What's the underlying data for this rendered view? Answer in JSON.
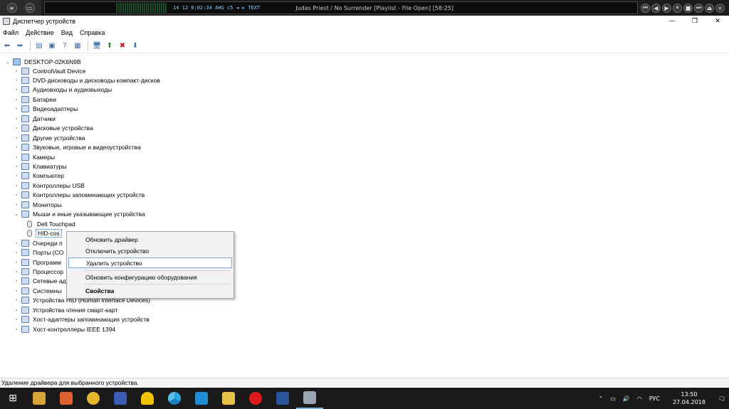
{
  "winamp": {
    "info": "14   12   0:02:34   AHG   c5   ◄   ►   TEXT",
    "track": "Judas Priest / No Surrender    [Playlist - File Open]  [58:25]"
  },
  "window": {
    "title": "Диспетчер устройств"
  },
  "menu": [
    "Файл",
    "Действие",
    "Вид",
    "Справка"
  ],
  "tree": {
    "root": "DESKTOP-02K6N9B",
    "items": [
      {
        "label": "ControlVault Device",
        "expanded": false
      },
      {
        "label": "DVD-дисководы и дисководы компакт-дисков",
        "expanded": false
      },
      {
        "label": "Аудиовходы и аудиовыходы",
        "expanded": false
      },
      {
        "label": "Батареи",
        "expanded": false
      },
      {
        "label": "Видеоадаптеры",
        "expanded": false
      },
      {
        "label": "Датчики",
        "expanded": false
      },
      {
        "label": "Дисковые устройства",
        "expanded": false
      },
      {
        "label": "Другие устройства",
        "expanded": false
      },
      {
        "label": "Звуковые, игровые и видеоустройства",
        "expanded": false
      },
      {
        "label": "Камеры",
        "expanded": false
      },
      {
        "label": "Клавиатуры",
        "expanded": false
      },
      {
        "label": "Компьютер",
        "expanded": false
      },
      {
        "label": "Контроллеры USB",
        "expanded": false
      },
      {
        "label": "Контроллеры запоминающих устройств",
        "expanded": false
      },
      {
        "label": "Мониторы",
        "expanded": false
      },
      {
        "label": "Мыши и иные указывающие устройства",
        "expanded": true
      },
      {
        "label": "Dell Touchpad",
        "child": true
      },
      {
        "label": "HID-cos",
        "child": true,
        "selected": true
      },
      {
        "label": "Очереди п",
        "expanded": false
      },
      {
        "label": "Порты (CO",
        "expanded": false
      },
      {
        "label": "Программ",
        "expanded": false
      },
      {
        "label": "Процессор",
        "expanded": false
      },
      {
        "label": "Сетевые ад",
        "expanded": false
      },
      {
        "label": "Системны",
        "expanded": false
      },
      {
        "label": "Устройства HID (Human Interface Devices)",
        "expanded": false
      },
      {
        "label": "Устройства чтения смарт-карт",
        "expanded": false
      },
      {
        "label": "Хост-адаптеры запоминающих устройств",
        "expanded": false
      },
      {
        "label": "Хост-контроллеры IEEE 1394",
        "expanded": false
      }
    ]
  },
  "context_menu": {
    "update_driver": "Обновить драйвер",
    "disable_device": "Отключить устройство",
    "uninstall_device": "Удалить устройство",
    "scan_hardware": "Обновить конфигурацию оборудования",
    "properties": "Свойства"
  },
  "status": {
    "text": "Удаление драйвера для выбранного устройства."
  },
  "taskbar": {
    "language": "РУС",
    "time": "13:50",
    "date": "27.04.2018"
  },
  "colors": {
    "accent": "#7aa7d8",
    "taskbar": "#1a1a1a",
    "delete_red": "#d0141b"
  }
}
